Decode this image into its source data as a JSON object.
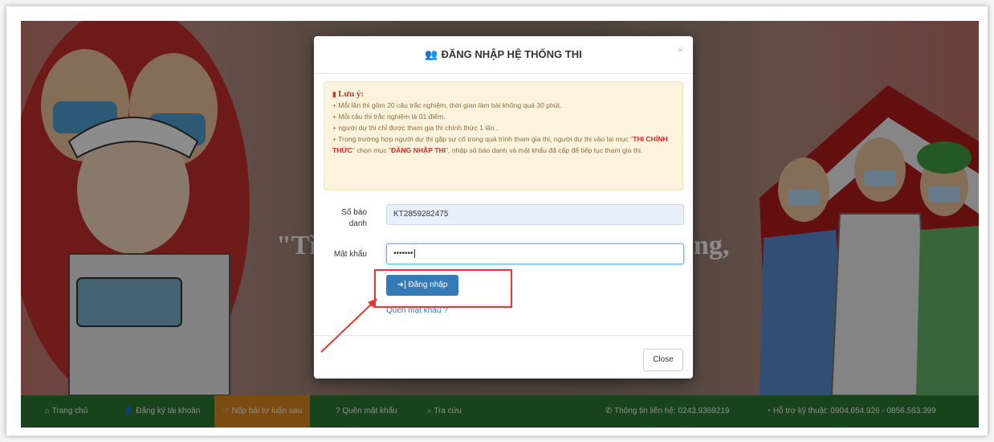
{
  "modal": {
    "title": "ĐĂNG NHẬP HỆ THỐNG THI",
    "close_x": "×",
    "notice": {
      "title": "Lưu ý:",
      "line1": "+ Mỗi lần thi gồm 20 câu trắc nghiệm, thời gian làm bài không quá 30 phút.",
      "line2": "+ Mỗi câu thi trắc nghiệm là 01 điểm.",
      "line3": "+ người dự thi chỉ được tham gia thi chính thức 1 lần .",
      "line4_a": "+ Trong trường hợp người dự thi gặp sự cố trong quá trình tham gia thi, người dự thi vào lại mục \"",
      "line4_b": "THI CHÍNH THỨC",
      "line4_c": "\" chọn mục \"",
      "line4_d": "ĐĂNG NHẬP THI",
      "line4_e": "\", nhập số báo danh và mật khẩu đã cấp để tiếp tục tham gia thi."
    },
    "sbd_label_1": "Số báo",
    "sbd_label_2": "danh",
    "sbd_value": "KT2859282475",
    "password_label": "Mật khẩu",
    "password_value": "•••••••",
    "login_button": "Đăng nhập",
    "forgot_link": "Quên mật khẩu ?",
    "close_button": "Close"
  },
  "banner": {
    "slogan_left": "\"Tì",
    "slogan_right": "ng,"
  },
  "nav": {
    "home": "Trang chủ",
    "register": "Đăng ký tài khoản",
    "submit_essay": "Nộp bài tự luận sau",
    "forgot": "Quên mật khẩu",
    "lookup": "Tra cứu",
    "contact": "Thông tin liên hệ: 0243.9369219",
    "support": "Hỗ trợ kỹ thuật: 0904.654.926 - 0856.563.399"
  },
  "colors": {
    "nav_bg": "#2e7d32",
    "nav_active": "#e08a1f",
    "primary": "#337ab7",
    "notice_bg": "#fcf3dc",
    "annotation_red": "#e53935"
  }
}
